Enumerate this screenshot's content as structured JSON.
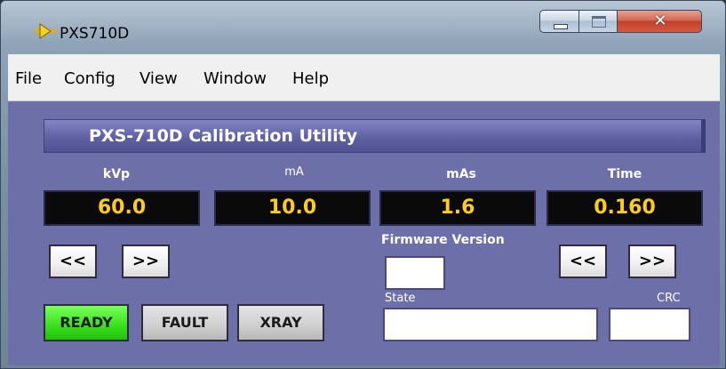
{
  "window": {
    "title": "PXS710D",
    "icon": "labview-run-arrow-icon",
    "colors": {
      "panel": "#6d6fa9",
      "display_text": "#ffcc1a",
      "ready_green": "#38e01c"
    }
  },
  "menubar": {
    "items": [
      {
        "label": "File"
      },
      {
        "label": "Config"
      },
      {
        "label": "View"
      },
      {
        "label": "Window"
      },
      {
        "label": "Help"
      }
    ]
  },
  "panel": {
    "title": "PXS-710D Calibration Utility",
    "readouts": [
      {
        "label": "kVp",
        "value": "60.0"
      },
      {
        "label": "mA",
        "value": "10.0"
      },
      {
        "label": "mAs",
        "value": "1.6"
      },
      {
        "label": "Time",
        "value": "0.160"
      }
    ],
    "kvp_buttons": {
      "decrease": "<<",
      "increase": ">>"
    },
    "time_buttons": {
      "decrease": "<<",
      "increase": ">>"
    },
    "firmware": {
      "label": "Firmware Version",
      "value": ""
    },
    "state": {
      "label": "State",
      "value": ""
    },
    "crc": {
      "label": "CRC",
      "value": ""
    },
    "status_buttons": [
      {
        "label": "READY",
        "active": true
      },
      {
        "label": "FAULT",
        "active": false
      },
      {
        "label": "XRAY",
        "active": false
      }
    ]
  }
}
